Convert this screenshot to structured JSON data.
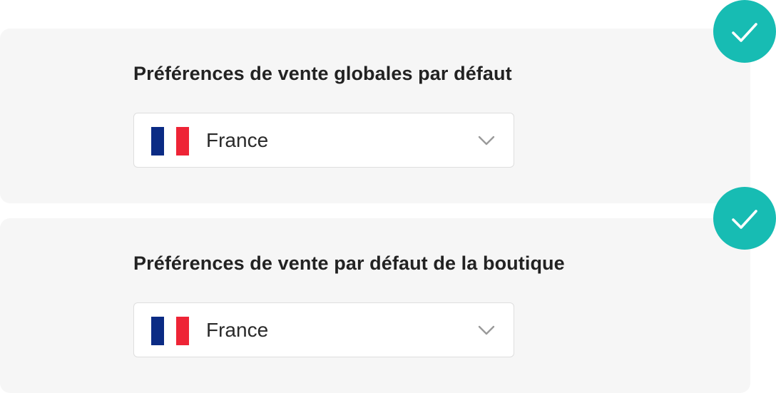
{
  "sections": [
    {
      "title": "Préférences de vente globales par défaut",
      "select": {
        "value": "France",
        "flag": "france-flag-icon"
      }
    },
    {
      "title": "Préférences de vente par défaut de la boutique",
      "select": {
        "value": "France",
        "flag": "france-flag-icon"
      }
    }
  ],
  "colors": {
    "card_background": "#f6f6f6",
    "check_badge": "#17bcb3",
    "flag_blue": "#0b2b84",
    "flag_red": "#ee2436",
    "title_text": "#222222"
  },
  "icons": {
    "check": "check-icon",
    "chevron": "chevron-down-icon"
  }
}
